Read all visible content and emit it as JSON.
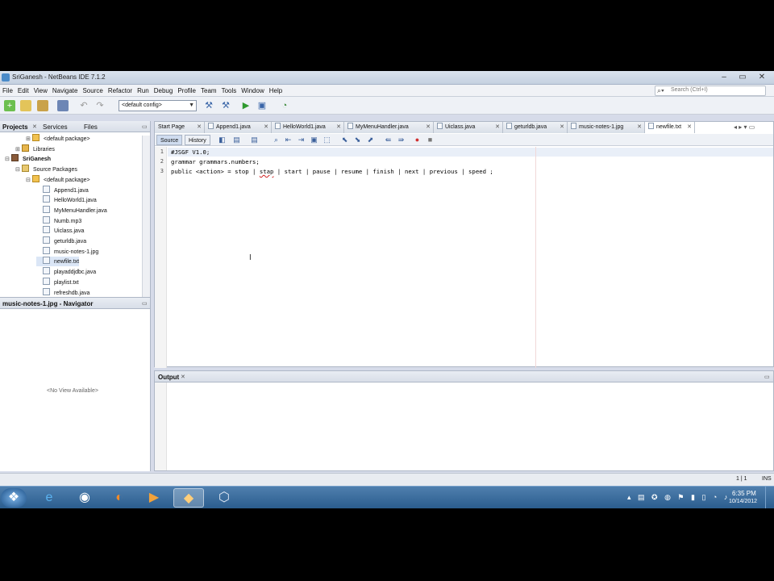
{
  "window": {
    "title": "SriGanesh - NetBeans IDE 7.1.2",
    "buttons": [
      "–",
      "▭",
      "✕"
    ]
  },
  "menu": [
    "File",
    "Edit",
    "View",
    "Navigate",
    "Source",
    "Refactor",
    "Run",
    "Debug",
    "Profile",
    "Team",
    "Tools",
    "Window",
    "Help"
  ],
  "search": {
    "placeholder": "Search (Ctrl+I)"
  },
  "toolbar": {
    "config": "<default config>"
  },
  "projects_panel": {
    "tabs": [
      "Projects",
      "Services",
      "Files"
    ],
    "tree": [
      {
        "label": "<default package>",
        "icon": "package-icon",
        "depth": 2,
        "expander": "+"
      },
      {
        "label": "Libraries",
        "icon": "library-icon",
        "depth": 1,
        "expander": "+"
      },
      {
        "label": "SriGanesh",
        "icon": "project-icon",
        "depth": 0,
        "expander": "−",
        "bold": true
      },
      {
        "label": "Source Packages",
        "icon": "source-packages-icon",
        "depth": 1,
        "expander": "−"
      },
      {
        "label": "<default package>",
        "icon": "package-icon",
        "depth": 2,
        "expander": "−"
      },
      {
        "label": "Append1.java",
        "icon": "java-file-icon",
        "depth": 3
      },
      {
        "label": "HelloWorld1.java",
        "icon": "java-file-icon",
        "depth": 3
      },
      {
        "label": "MyMenuHandler.java",
        "icon": "java-file-icon",
        "depth": 3
      },
      {
        "label": "Numb.mp3",
        "icon": "file-icon",
        "depth": 3
      },
      {
        "label": "Uiclass.java",
        "icon": "java-file-icon",
        "depth": 3
      },
      {
        "label": "geturldb.java",
        "icon": "java-file-icon",
        "depth": 3
      },
      {
        "label": "music-notes-1.jpg",
        "icon": "image-file-icon",
        "depth": 3
      },
      {
        "label": "newfile.txt",
        "icon": "file-icon",
        "depth": 3,
        "selected": true
      },
      {
        "label": "playaddjdbc.java",
        "icon": "java-file-icon",
        "depth": 3
      },
      {
        "label": "playlist.txt",
        "icon": "file-icon",
        "depth": 3
      },
      {
        "label": "refreshdb.java",
        "icon": "java-file-icon",
        "depth": 3
      }
    ]
  },
  "navigator": {
    "title": "music-notes-1.jpg - Navigator",
    "empty": "<No View Available>"
  },
  "editor": {
    "tabs": [
      "Start Page",
      "Append1.java",
      "HelloWorld1.java",
      "MyMenuHandler.java",
      "Uiclass.java",
      "geturldb.java",
      "music-notes-1.jpg",
      "newfile.txt"
    ],
    "active_tab": "newfile.txt",
    "source_label": "Source",
    "history_label": "History",
    "lines": [
      {
        "num": "1",
        "text": "#JSGF V1.0;"
      },
      {
        "num": "2",
        "text": "grammar grammars.numbers;"
      },
      {
        "num": "3",
        "pre": "public <action> = stop | ",
        "err": "stap",
        "post": " | start | pause | resume | finish | next | previous | speed ;"
      }
    ]
  },
  "output": {
    "title": "Output"
  },
  "status": {
    "position": "1 | 1",
    "mode": "INS"
  },
  "taskbar": {
    "apps": [
      "windows-start-icon",
      "internet-explorer-icon",
      "chrome-icon",
      "firefox-icon",
      "media-player-icon",
      "netbeans-icon",
      "virtualbox-icon"
    ],
    "time": "6:35 PM",
    "date": "10/14/2012"
  }
}
